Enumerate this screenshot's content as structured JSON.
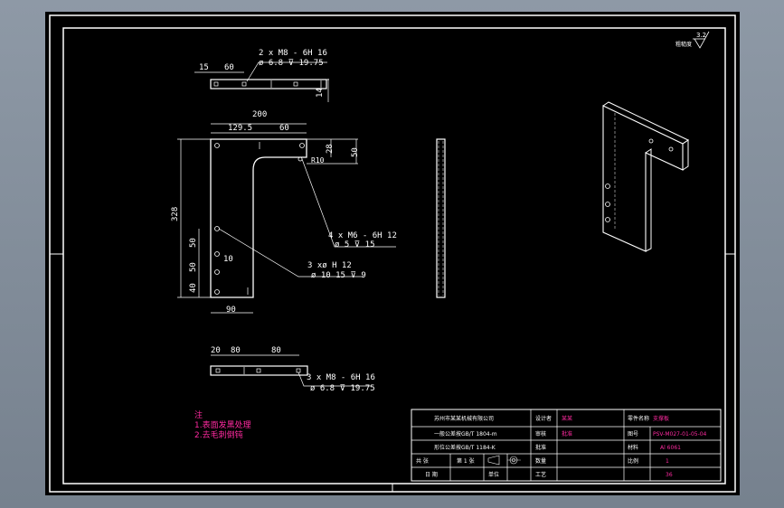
{
  "surface": {
    "label": "粗糙度",
    "roughness": "3.2"
  },
  "top_view": {
    "dims": [
      "15",
      "60",
      "14"
    ],
    "callout_line1": "2 x  M8 - 6H 16",
    "callout_line2": "ø 6.8 ⊽ 19.75"
  },
  "front_view": {
    "dims": [
      "200",
      "129.5",
      "60",
      "28",
      "50",
      "328",
      "50",
      "50",
      "10",
      "40",
      "90"
    ],
    "r": "R10",
    "callout_m6_line1": "4 x  M6 - 6H 12",
    "callout_m6_line2": "ø 5 ⊽ 15",
    "callout_pin_line1": "3 xø   H 12",
    "callout_pin_line2": "ø 10   15 ⊽ 9"
  },
  "bottom_view": {
    "dims": [
      "20",
      "80",
      "80"
    ],
    "callout_line1": "3 x  M8 - 6H 16",
    "callout_line2": "ø 6.8 ⊽ 19.75"
  },
  "notes": {
    "heading": "注",
    "items": [
      "1.表面发黑处理",
      "2.去毛刺倒钝"
    ]
  },
  "title_block": {
    "company": "苏州市某某机械有限公司",
    "std1": "一般公差按GB/T 1804-m",
    "std2": "形位公差按GB/T 1184-K",
    "designer_label": "设计者",
    "designer_value": "某某",
    "checker_label": "审核",
    "checker_value": "批准",
    "approve_label": "批准",
    "drawing_name_label": "零件名称",
    "drawing_name_value": "支撑板",
    "drawing_no_label": "图号",
    "drawing_no_value": "PSV-M027-01-05-04",
    "material_label": "材料",
    "material_value": "Al 6061",
    "scale_label": "比例",
    "scale_value": "1:5",
    "qty_label": "数量",
    "qty_value": "1",
    "sheet_label": "共  张",
    "sheet_value": "第 1 张",
    "weight_label": "工艺",
    "weight_value": "36",
    "date_label": "日 期",
    "unit_label": "单位"
  }
}
